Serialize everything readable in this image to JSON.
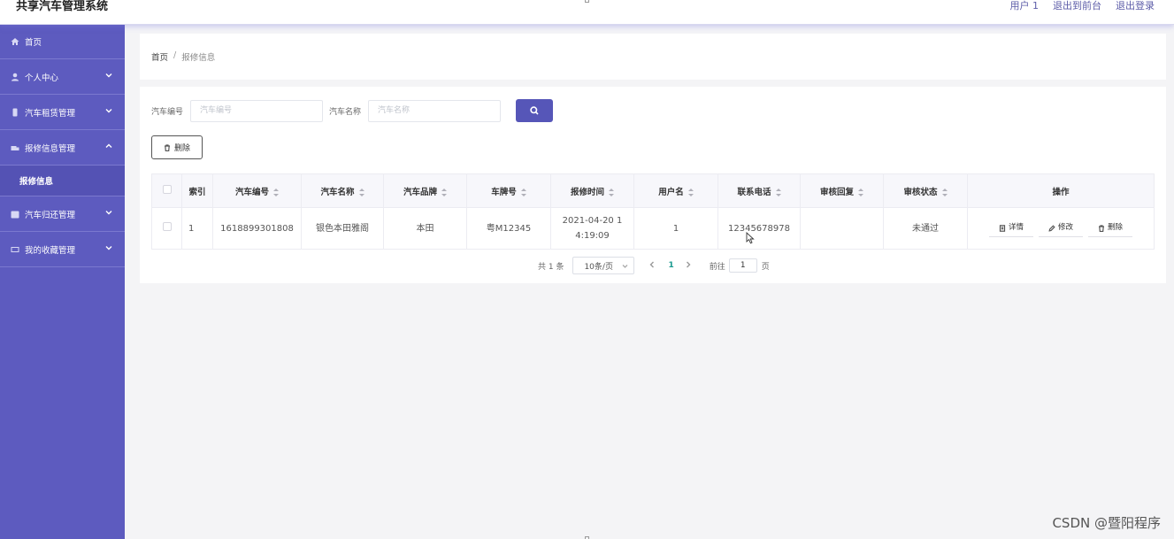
{
  "app": {
    "title": "共享汽车管理系统"
  },
  "topbar": {
    "user": "用户 1",
    "front": "退出到前台",
    "logout": "退出登录"
  },
  "sidebar": {
    "items": [
      {
        "label": "首页",
        "icon": "home-icon"
      },
      {
        "label": "个人中心",
        "icon": "user-icon"
      },
      {
        "label": "汽车租赁管理",
        "icon": "phone-icon"
      },
      {
        "label": "报修信息管理",
        "icon": "truck-icon"
      },
      {
        "label": "汽车归还管理",
        "icon": "calendar-icon"
      },
      {
        "label": "我的收藏管理",
        "icon": "card-icon"
      }
    ],
    "sub": {
      "label": "报修信息"
    }
  },
  "breadcrumb": {
    "home": "首页",
    "sep": "/",
    "current": "报修信息"
  },
  "search": {
    "car_no_label": "汽车编号",
    "car_no_placeholder": "汽车编号",
    "car_name_label": "汽车名称",
    "car_name_placeholder": "汽车名称"
  },
  "actions": {
    "delete_label": "删除"
  },
  "table": {
    "headers": [
      "索引",
      "汽车编号",
      "汽车名称",
      "汽车品牌",
      "车牌号",
      "报修时间",
      "用户名",
      "联系电话",
      "审核回复",
      "审核状态",
      "操作"
    ],
    "rows": [
      {
        "index": "1",
        "car_no": "1618899301808",
        "car_name": "银色本田雅阁",
        "brand": "本田",
        "plate": "粤M12345",
        "time": "2021-04-20 14:19:09",
        "username": "1",
        "phone": "12345678978",
        "reply": "",
        "status": "未通过"
      }
    ],
    "ops": {
      "detail": "详情",
      "edit": "修改",
      "delete": "删除"
    }
  },
  "pagination": {
    "total": "共 1 条",
    "page_size": "10条/页",
    "current": "1",
    "goto_prefix": "前往",
    "goto_value": "1",
    "goto_suffix": "页"
  },
  "watermark": "CSDN @暨阳程序",
  "colors": {
    "sidebar": "#5d5bbf",
    "accent": "#5656b8",
    "active_page": "#1a9a8f"
  }
}
